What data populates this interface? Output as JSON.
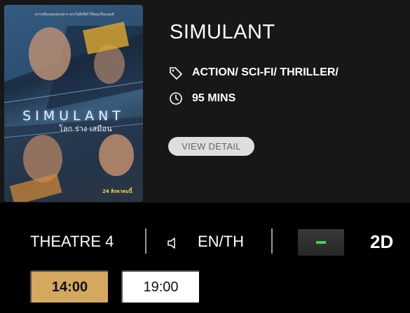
{
  "movie": {
    "title": "SIMULANT",
    "genre": "ACTION/ SCI-FI/ THRILLER/",
    "duration": "95 MINS",
    "view_detail_label": "VIEW DETAIL",
    "poster": {
      "tagline": "เขาเหมือนคุณทุกอย่าง ยกเว้นสิ่งที่ทำให้คุณเป็นมนุษย์",
      "title": "SIMULANT",
      "subtitle": "โลก ร่าง เสมือน",
      "date": "24 สิงหาคมนี้"
    }
  },
  "showtime": {
    "theatre": "THEATRE 4",
    "language": "EN/TH",
    "format": "2D",
    "times": [
      {
        "label": "14:00",
        "selected": true
      },
      {
        "label": "19:00",
        "selected": false
      }
    ]
  },
  "icons": {
    "genre": "tag-icon",
    "duration": "clock-icon",
    "language": "speaker-icon",
    "toggle": "minus-icon"
  },
  "colors": {
    "selected_time": "#d4a85e",
    "toggle_indicator": "#3cd44c",
    "view_detail_bg": "#dedede"
  }
}
